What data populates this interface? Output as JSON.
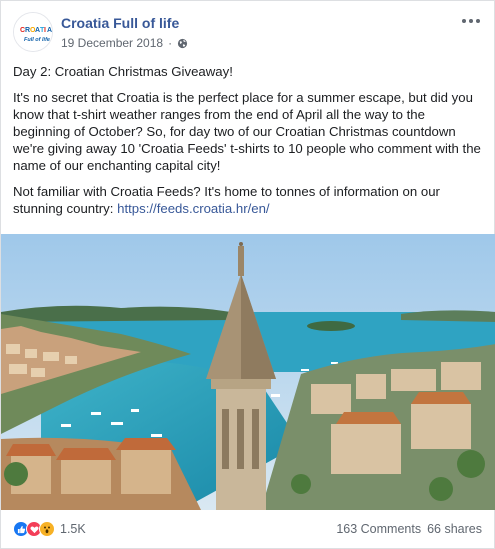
{
  "post": {
    "author": "Croatia Full of life",
    "date": "19 December 2018",
    "audience_icon": "globe-icon",
    "logo_text_top": "CROATIA",
    "logo_text_bottom": "Full of life",
    "paragraphs": [
      "Day 2: Croatian Christmas Giveaway!",
      "It's no secret that Croatia is the perfect place for a summer escape, but did you know that t-shirt weather ranges from the end of April all the way to the beginning of October? So, for day two of our Croatian Christmas countdown we're giving away 10 'Croatia Feeds' t-shirts to 10 people who comment with the name of our enchanting capital city!"
    ],
    "paragraph3_prefix": "Not familiar with Croatia Feeds? It's home to tonnes of information on our stunning country: ",
    "link": "https://feeds.croatia.hr/en/"
  },
  "footer": {
    "reaction_count": "1.5K",
    "comments": "163 Comments",
    "shares": "66 shares"
  },
  "colors": {
    "link": "#385898",
    "like": "#1877f2",
    "love": "#f33e58",
    "wow": "#f7b125"
  }
}
